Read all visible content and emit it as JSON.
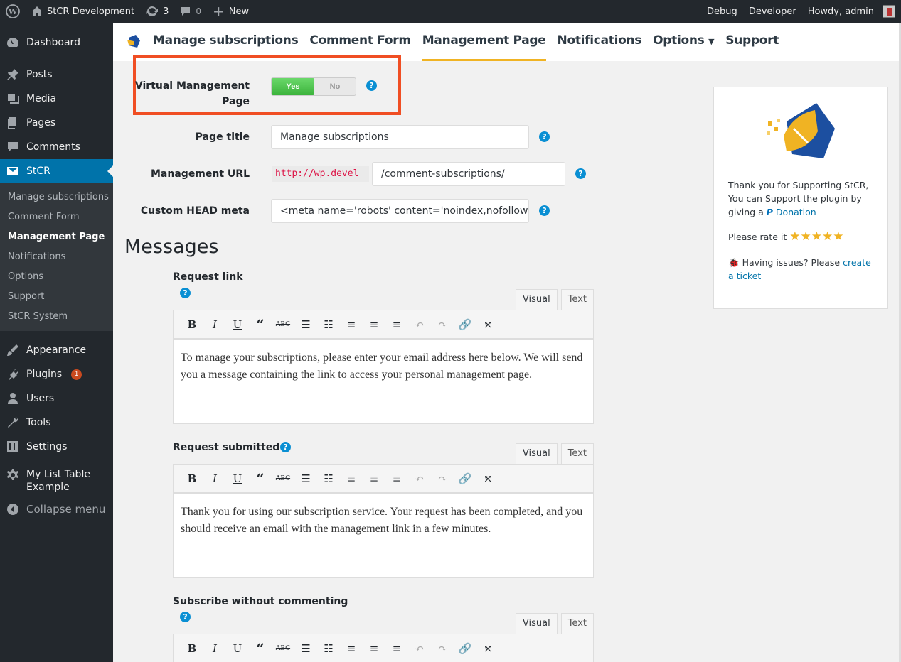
{
  "admin_bar": {
    "site": "StCR Development",
    "updates": "3",
    "comments": "0",
    "new": "New",
    "debug": "Debug",
    "developer": "Developer",
    "howdy": "Howdy, admin"
  },
  "sidebar": {
    "items": [
      {
        "label": "Dashboard",
        "icon": "dashboard-icon"
      },
      {
        "label": "Posts",
        "icon": "pin-icon"
      },
      {
        "label": "Media",
        "icon": "media-icon"
      },
      {
        "label": "Pages",
        "icon": "pages-icon"
      },
      {
        "label": "Comments",
        "icon": "comment-icon"
      },
      {
        "label": "StCR",
        "icon": "mail-icon"
      }
    ],
    "submenu": [
      "Manage subscriptions",
      "Comment Form",
      "Management Page",
      "Notifications",
      "Options",
      "Support",
      "StCR System"
    ],
    "items2": [
      {
        "label": "Appearance"
      },
      {
        "label": "Plugins",
        "badge": "1"
      },
      {
        "label": "Users"
      },
      {
        "label": "Tools"
      },
      {
        "label": "Settings"
      },
      {
        "label": "My List Table Example"
      },
      {
        "label": "Collapse menu"
      }
    ]
  },
  "tabs": [
    "Manage subscriptions",
    "Comment Form",
    "Management Page",
    "Notifications",
    "Options",
    "Support"
  ],
  "form": {
    "virtual_label": "Virtual Management Page",
    "yes": "Yes",
    "no": "No",
    "page_title_label": "Page title",
    "page_title_value": "Manage subscriptions",
    "url_label": "Management URL",
    "url_prefix": "http://wp.devel",
    "url_value": "/comment-subscriptions/",
    "meta_label": "Custom HEAD meta",
    "meta_value": "<meta name='robots' content='noindex,nofollow'>"
  },
  "messages": {
    "heading": "Messages",
    "editors": [
      {
        "label": "Request link",
        "text": "To manage your subscriptions, please enter your email address here below. We will send you a message containing the link to access your personal management page."
      },
      {
        "label": "Request submitted",
        "text": "Thank you for using our subscription service. Your request has been completed, and you should receive an email with the management link in a few minutes."
      },
      {
        "label": "Subscribe without commenting",
        "text": ""
      }
    ],
    "visual": "Visual",
    "text_tab": "Text"
  },
  "support_box": {
    "line1": "Thank you for Supporting StCR, You can Support the plugin by giving a",
    "donation": "Donation",
    "rate": "Please rate it",
    "issues": "Having issues? Please",
    "ticket": "create a ticket"
  },
  "colors": {
    "accent": "#0073aa",
    "highlight": "#f04e23",
    "tab_underline": "#f0b323"
  }
}
